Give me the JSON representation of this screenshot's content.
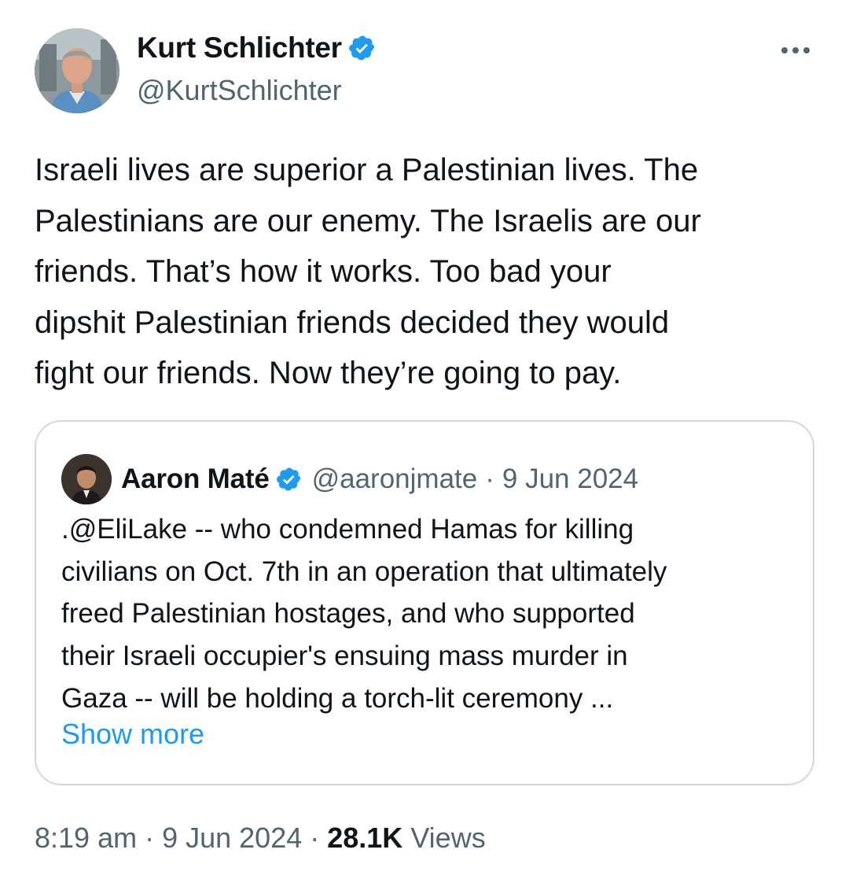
{
  "author": {
    "name": "Kurt Schlichter",
    "handle": "@KurtSchlichter",
    "verified": true
  },
  "tweet": {
    "text_lines": [
      "Israeli lives are superior a Palestinian lives. The",
      "Palestinians are our enemy. The Israelis are our",
      "friends. That’s how it works. Too bad your",
      "dipshit Palestinian friends decided they would",
      "fight our friends. Now they’re going to pay."
    ]
  },
  "quote": {
    "name": "Aaron Maté",
    "handle": "@aaronjmate",
    "separator": "·",
    "date": "9 Jun 2024",
    "text_lines": [
      ".@EliLake -- who condemned Hamas for killing",
      "civilians on Oct. 7th in an operation that ultimately",
      "freed Palestinian hostages, and who supported",
      "their Israeli occupier's ensuing mass murder in",
      "Gaza -- will be holding a torch-lit ceremony ..."
    ],
    "show_more_label": "Show more"
  },
  "meta": {
    "time": "8:19 am",
    "separator": "·",
    "date": "9 Jun 2024",
    "views_count": "28.1K",
    "views_label": "Views"
  },
  "icons": {
    "verified": "verified-badge-icon",
    "more": "more-horizontal-icon"
  },
  "colors": {
    "accent": "#1d9bf0",
    "text_primary": "#0f1419",
    "text_secondary": "#536471",
    "border": "#cfd9de"
  }
}
